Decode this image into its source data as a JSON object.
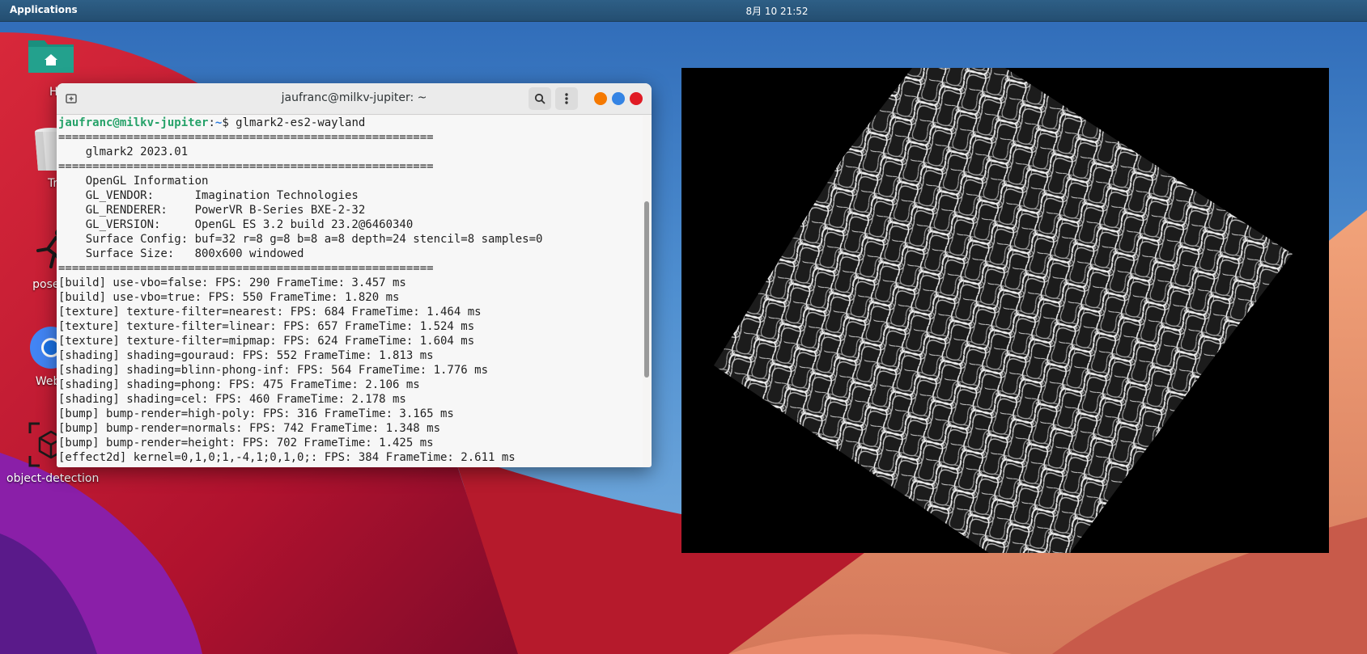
{
  "topbar": {
    "applications_label": "Applications",
    "clock": "8月 10 21:52"
  },
  "desktop_icons": [
    {
      "label": "Hon",
      "icon": "home-folder-icon"
    },
    {
      "label": "Tras",
      "icon": "trash-icon"
    },
    {
      "label": "pose-tr",
      "icon": "running-figure-icon"
    },
    {
      "label": "Web Br",
      "icon": "web-browser-icon"
    },
    {
      "label": "object-detection",
      "icon": "cube-detection-icon"
    }
  ],
  "terminal": {
    "title": "jaufranc@milkv-jupiter: ~",
    "prompt": {
      "user": "jaufranc@milkv-jupiter",
      "path": "~",
      "symbol": "$ ",
      "command": "glmark2-es2-wayland"
    },
    "lines": [
      "=======================================================",
      "    glmark2 2023.01",
      "=======================================================",
      "    OpenGL Information",
      "    GL_VENDOR:      Imagination Technologies",
      "    GL_RENDERER:    PowerVR B-Series BXE-2-32",
      "    GL_VERSION:     OpenGL ES 3.2 build 23.2@6460340",
      "    Surface Config: buf=32 r=8 g=8 b=8 a=8 depth=24 stencil=8 samples=0",
      "    Surface Size:   800x600 windowed",
      "=======================================================",
      "[build] use-vbo=false: FPS: 290 FrameTime: 3.457 ms",
      "[build] use-vbo=true: FPS: 550 FrameTime: 1.820 ms",
      "[texture] texture-filter=nearest: FPS: 684 FrameTime: 1.464 ms",
      "[texture] texture-filter=linear: FPS: 657 FrameTime: 1.524 ms",
      "[texture] texture-filter=mipmap: FPS: 624 FrameTime: 1.604 ms",
      "[shading] shading=gouraud: FPS: 552 FrameTime: 1.813 ms",
      "[shading] shading=blinn-phong-inf: FPS: 564 FrameTime: 1.776 ms",
      "[shading] shading=phong: FPS: 475 FrameTime: 2.106 ms",
      "[shading] shading=cel: FPS: 460 FrameTime: 2.178 ms",
      "[bump] bump-render=high-poly: FPS: 316 FrameTime: 3.165 ms",
      "[bump] bump-render=normals: FPS: 742 FrameTime: 1.348 ms",
      "[bump] bump-render=height: FPS: 702 FrameTime: 1.425 ms",
      "[effect2d] kernel=0,1,0;1,-4,1;0,1,0;: FPS: 384 FrameTime: 2.611 ms"
    ]
  },
  "colors": {
    "close": "#e01b24",
    "maximize": "#3584e4",
    "minimize": "#f57900",
    "prompt_user": "#26a269",
    "prompt_path": "#2a7bde"
  }
}
